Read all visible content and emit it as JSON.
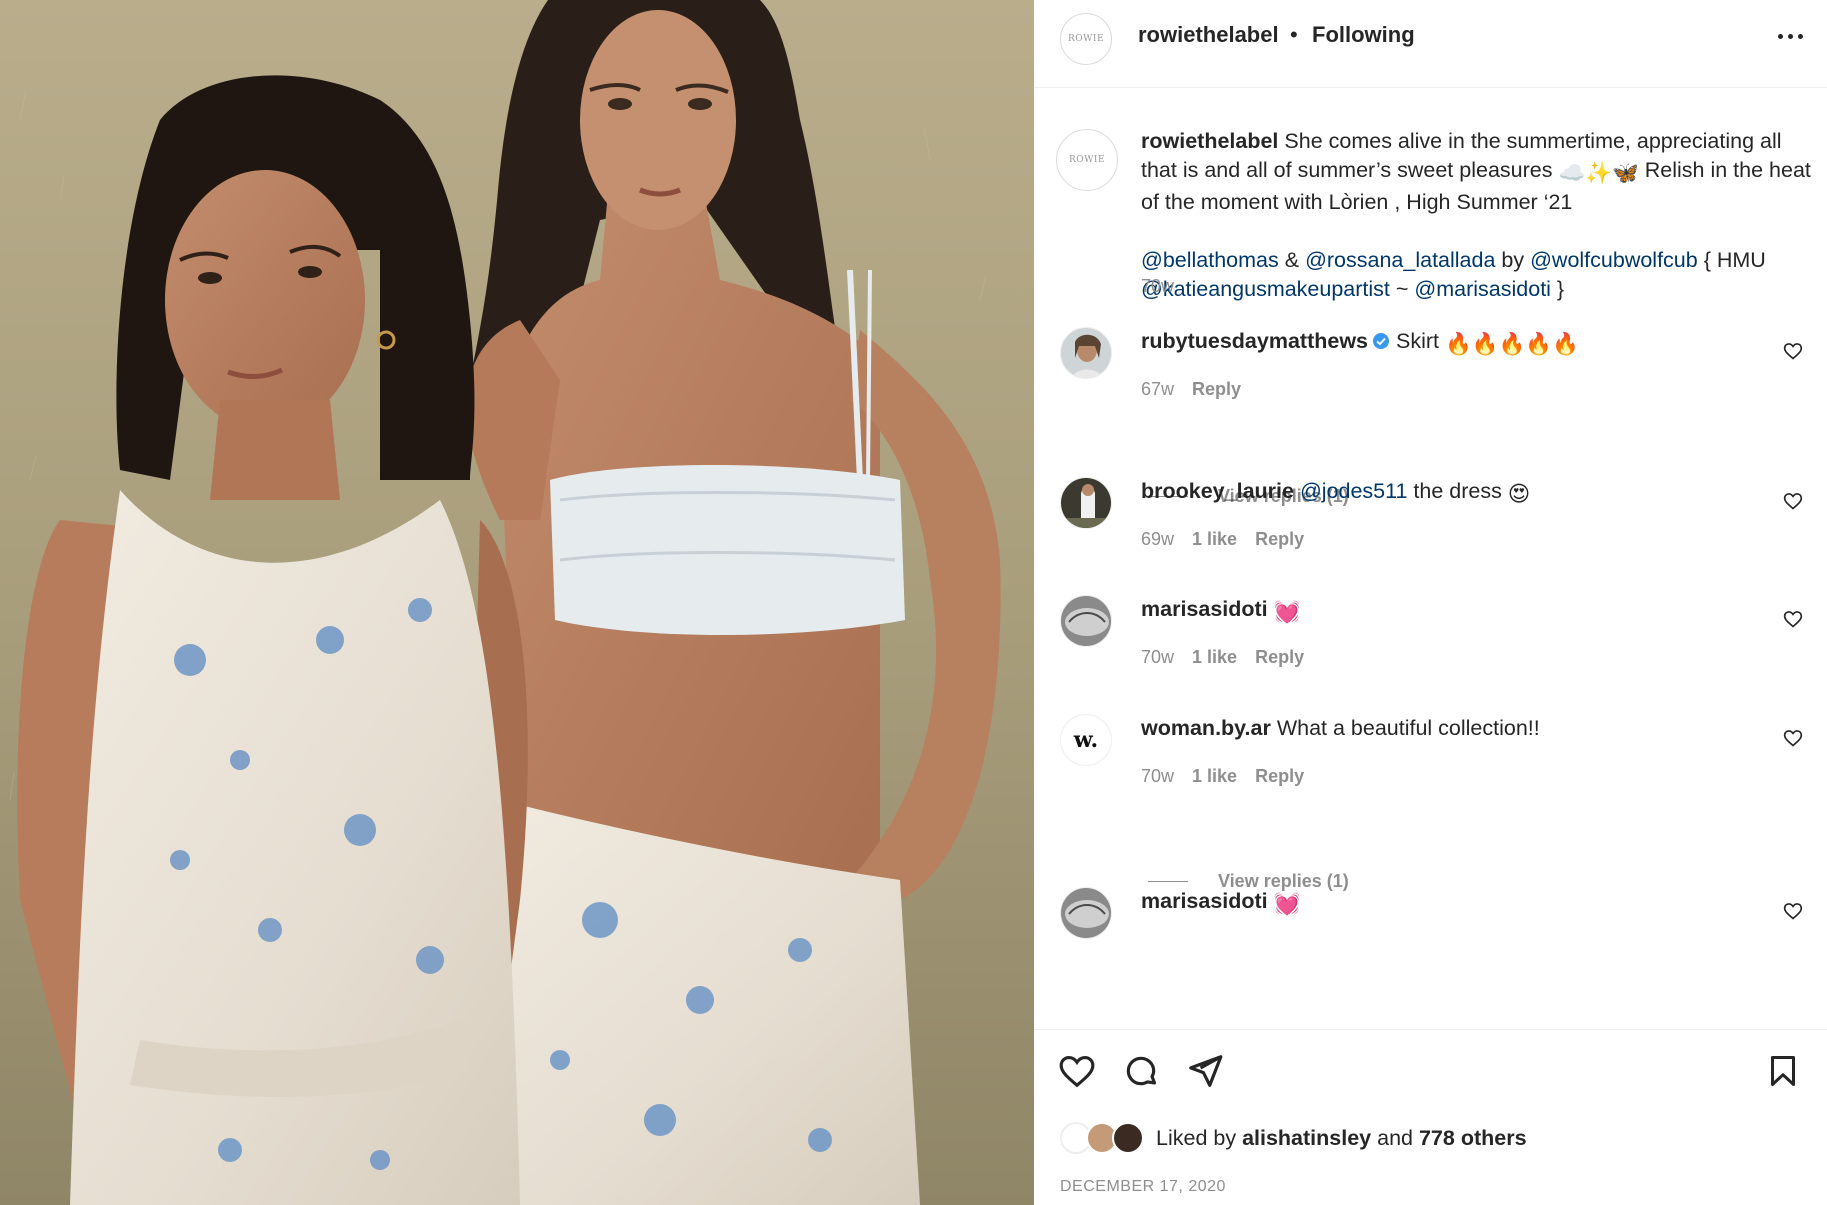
{
  "post": {
    "username": "rowiethelabel",
    "separator": "•",
    "follow_state": "Following",
    "avatar_text": "ROWIE"
  },
  "caption": {
    "username": "rowiethelabel",
    "text_1": "She comes alive in the summertime, appreciating all that is and all of summer’s sweet pleasures ",
    "emoji": "☁️✨🦋",
    "text_2": " Relish in the heat of the moment with Lòrien , High Summer ‘21",
    "mention_1": "@bellathomas",
    "amp": " & ",
    "mention_2": "@rossana_latallada",
    "by": " by ",
    "mention_3": "@wolfcubwolfcub",
    "hmu": " { HMU",
    "mention_4": "@katieangusmakeupartist",
    "tilde": " ~ ",
    "mention_5": "@marisasidoti",
    "close": " }",
    "time": "70w"
  },
  "comments": [
    {
      "username": "rubytuesdaymatthews",
      "verified": true,
      "text": " Skirt ",
      "emoji": "🔥🔥🔥🔥🔥",
      "time": "67w",
      "likes": "",
      "reply": "Reply",
      "view_replies": "View replies (1)"
    },
    {
      "username": "brookey_laurie",
      "mention": "@jodes511",
      "text": " the dress ",
      "emoji": "😍",
      "time": "69w",
      "likes": "1 like",
      "reply": "Reply"
    },
    {
      "username": "marisasidoti",
      "text": " ",
      "emoji": "💓",
      "time": "70w",
      "likes": "1 like",
      "reply": "Reply"
    },
    {
      "username": "woman.by.ar",
      "avatar_text": "w.",
      "text": " What a beautiful collection!!",
      "time": "70w",
      "likes": "1 like",
      "reply": "Reply",
      "view_replies": "View replies (1)"
    },
    {
      "username": "marisasidoti",
      "text": " ",
      "emoji": "💓"
    }
  ],
  "footer": {
    "liked_by_prefix": "Liked by ",
    "liked_by_user": "alishatinsley",
    "liked_by_mid": " and ",
    "liked_by_others": "778 others",
    "date": "DECEMBER 17, 2020"
  },
  "icons": [
    "heart-icon",
    "comment-icon",
    "share-icon",
    "bookmark-icon",
    "more-options-icon",
    "verified-badge-icon"
  ],
  "colors": {
    "mention": "#00376b",
    "muted": "#8e8e8e",
    "text": "#262626",
    "verified": "#3897f0"
  }
}
